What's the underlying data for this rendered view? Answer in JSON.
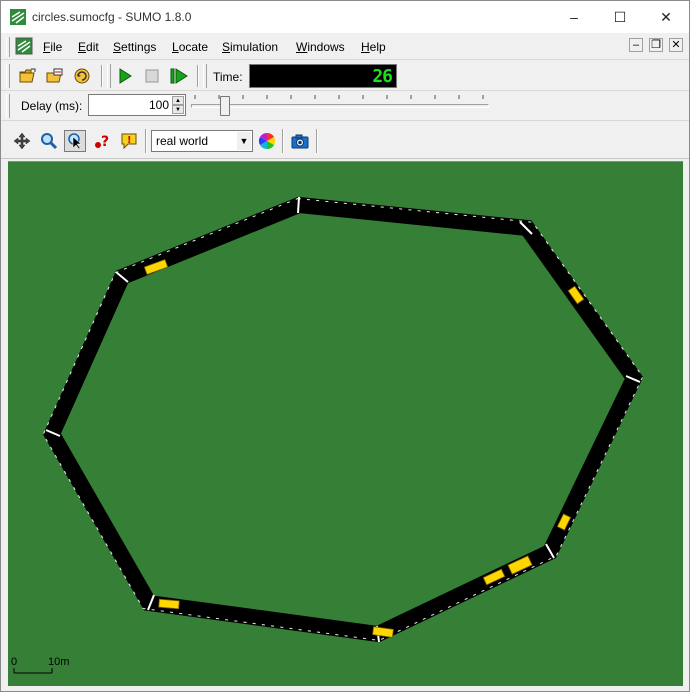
{
  "window": {
    "title": "circles.sumocfg - SUMO 1.8.0",
    "controls": {
      "minimize": "–",
      "maximize": "☐",
      "close": "✕"
    }
  },
  "menu": {
    "items": [
      {
        "label": "File",
        "underline": "F",
        "rest": "ile"
      },
      {
        "label": "Edit",
        "underline": "E",
        "rest": "dit"
      },
      {
        "label": "Settings",
        "underline": "S",
        "rest": "ettings"
      },
      {
        "label": "Locate",
        "underline": "L",
        "rest": "ocate"
      },
      {
        "label": "Simulation",
        "underline": "S",
        "rest": "imulation"
      },
      {
        "label": "Windows",
        "underline": "W",
        "rest": "indows"
      },
      {
        "label": "Help",
        "underline": "H",
        "rest": "elp"
      }
    ],
    "mdi_controls": {
      "minimize": "–",
      "restore": "❐",
      "close": "✕"
    }
  },
  "toolbar": {
    "file_icons": [
      "open-folder-icon",
      "open-network-icon",
      "reload-icon"
    ],
    "sim_icons": [
      "play-icon",
      "stop-icon",
      "step-icon"
    ],
    "time_label": "Time:",
    "time_value": "26",
    "delay_label": "Delay (ms):",
    "delay_value": "100",
    "delay_slider_fraction": 0.1
  },
  "view_toolbar": {
    "icons": [
      "recenter-view-icon",
      "zoom-icon",
      "locate-cursor-icon",
      "help-query-icon",
      "breakpoint-icon"
    ],
    "scheme_value": "real world",
    "color_icon": "color-wheel-icon",
    "screenshot_icon": "camera-icon"
  },
  "scene": {
    "scale_start": "0",
    "scale_end": "10m"
  },
  "colors": {
    "ground": "#367f37",
    "road": "#000000",
    "vehicle": "#ffd700",
    "time_digits": "#1ee01e"
  }
}
